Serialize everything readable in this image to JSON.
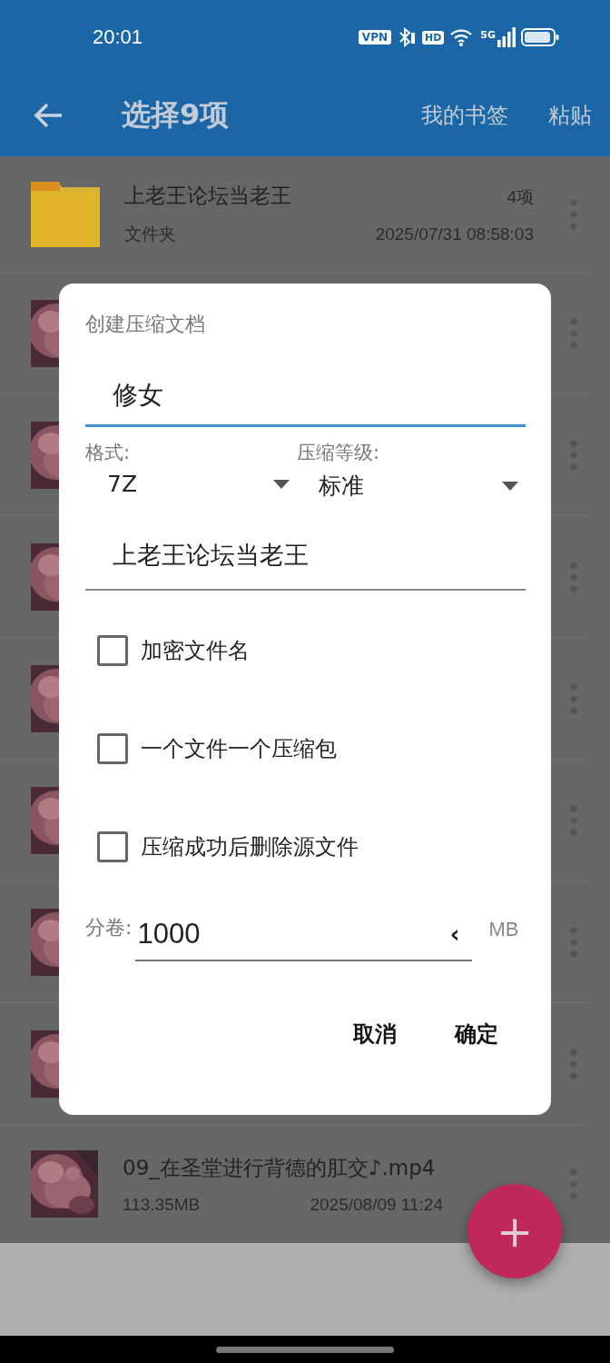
{
  "status_bar": {
    "time": "20:01",
    "vpn_label": "VPN",
    "hd_label": "HD",
    "network_label": "5G"
  },
  "app_bar": {
    "title": "选择9项",
    "actions": [
      "我的书签",
      "粘贴"
    ]
  },
  "files": [
    {
      "kind": "folder",
      "name": "上老王论坛当老王",
      "count": "4项",
      "type_label": "文件夹",
      "modified": "2025/07/31 08:58:03"
    },
    {
      "kind": "video"
    },
    {
      "kind": "video"
    },
    {
      "kind": "video"
    },
    {
      "kind": "video"
    },
    {
      "kind": "video"
    },
    {
      "kind": "video"
    },
    {
      "kind": "video"
    },
    {
      "kind": "video",
      "name": "09_在圣堂进行背德的肛交♪.mp4",
      "size": "113.35MB",
      "modified": "2025/08/09 11:24"
    }
  ],
  "dialog": {
    "title": "创建压缩文档",
    "name_value": "修女",
    "format": {
      "label": "格式:",
      "value": "7Z"
    },
    "level": {
      "label": "压缩等级:",
      "value": "标准"
    },
    "password_value": "上老王论坛当老王",
    "options": [
      {
        "label": "加密文件名",
        "checked": false
      },
      {
        "label": "一个文件一个压缩包",
        "checked": false
      },
      {
        "label": "压缩成功后删除源文件",
        "checked": false
      }
    ],
    "volume": {
      "label": "分卷:",
      "value": "1000",
      "clear_glyph": "‹",
      "unit": "MB"
    },
    "buttons": [
      "取消",
      "确定"
    ]
  },
  "fab": {
    "glyph": "+"
  }
}
